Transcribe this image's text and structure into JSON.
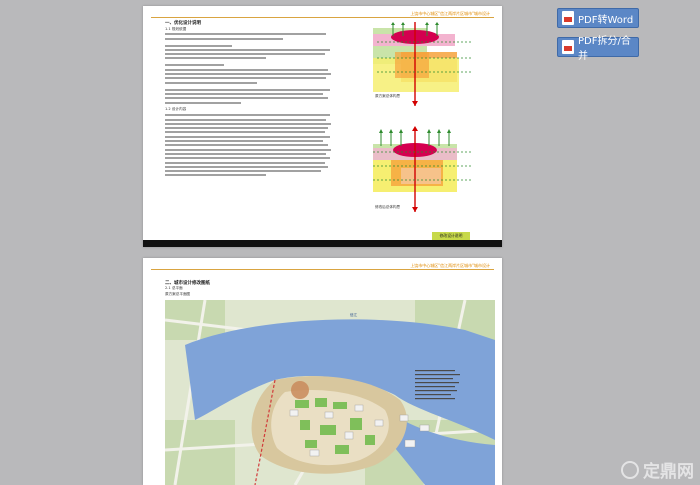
{
  "toolbar": {
    "pdf_to_word": "PDF转Word",
    "pdf_split_merge": "PDF拆分/合并"
  },
  "page1": {
    "header": "上饶市中心城区\"信江两岸片区城市\"城市设计",
    "section_title": "一、优化设计说明",
    "subsection_1": "1.1 规划依据",
    "subsection_2": "1.2 设计内容",
    "diagram_top_caption": "原方案总体构思",
    "diagram_bottom_caption": "修改后总体构思",
    "footer_tab": "修改设计说明"
  },
  "page2": {
    "header": "上饶市中心城区\"信江两岸片区城市\"城市设计",
    "section_title": "二、城市设计修改图纸",
    "subsection": "2.1 总平面",
    "plan_caption": "原方案总平面图",
    "river_label": "信江"
  },
  "watermark": {
    "text": "定鼎网"
  },
  "colors": {
    "background": "#b9b9bb",
    "button": "#5b87c6",
    "header_accent": "#e08a00",
    "footer_tab": "#c7d94a",
    "river": "#7fa3d8"
  }
}
